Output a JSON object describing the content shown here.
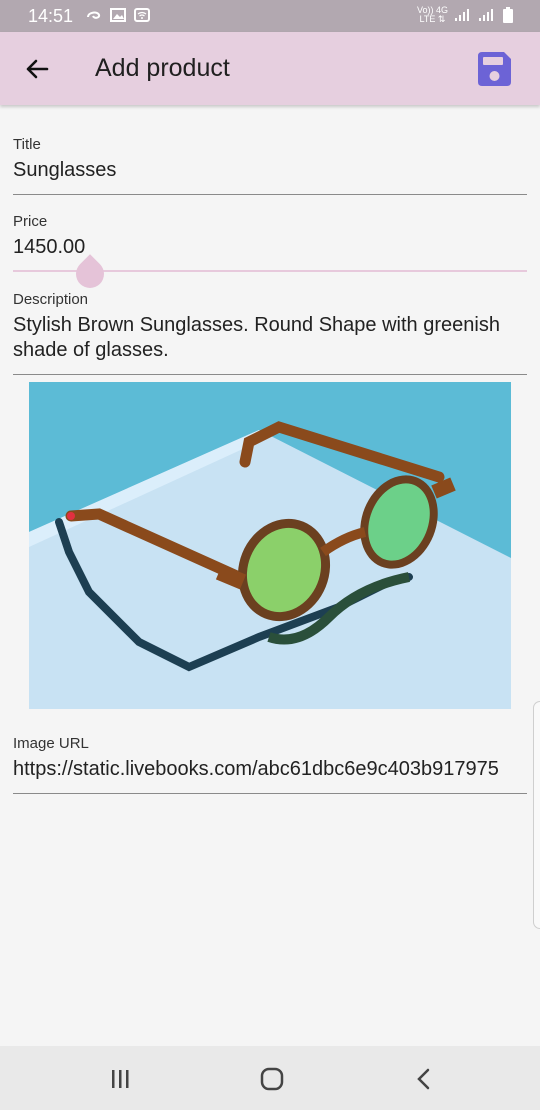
{
  "status_bar": {
    "time": "14:51",
    "network_line1": "Vo)) 4G",
    "network_line2": "LTE ⇅"
  },
  "app_bar": {
    "title": "Add product",
    "back_icon": "arrow-back-icon",
    "save_icon": "save-icon",
    "accent_color": "#6c63d6"
  },
  "form": {
    "title": {
      "label": "Title",
      "value": "Sunglasses"
    },
    "price": {
      "label": "Price",
      "value": "1450.00"
    },
    "description": {
      "label": "Description",
      "value": "Stylish Brown Sunglasses. Round Shape with greenish shade of glasses."
    },
    "image_url": {
      "label": "Image URL",
      "value": "https://static.livebooks.com/abc61dbc6e9c403b917975"
    }
  },
  "nav_bar": {
    "recents_icon": "recents-icon",
    "home_icon": "home-icon",
    "back_icon": "nav-back-icon"
  }
}
